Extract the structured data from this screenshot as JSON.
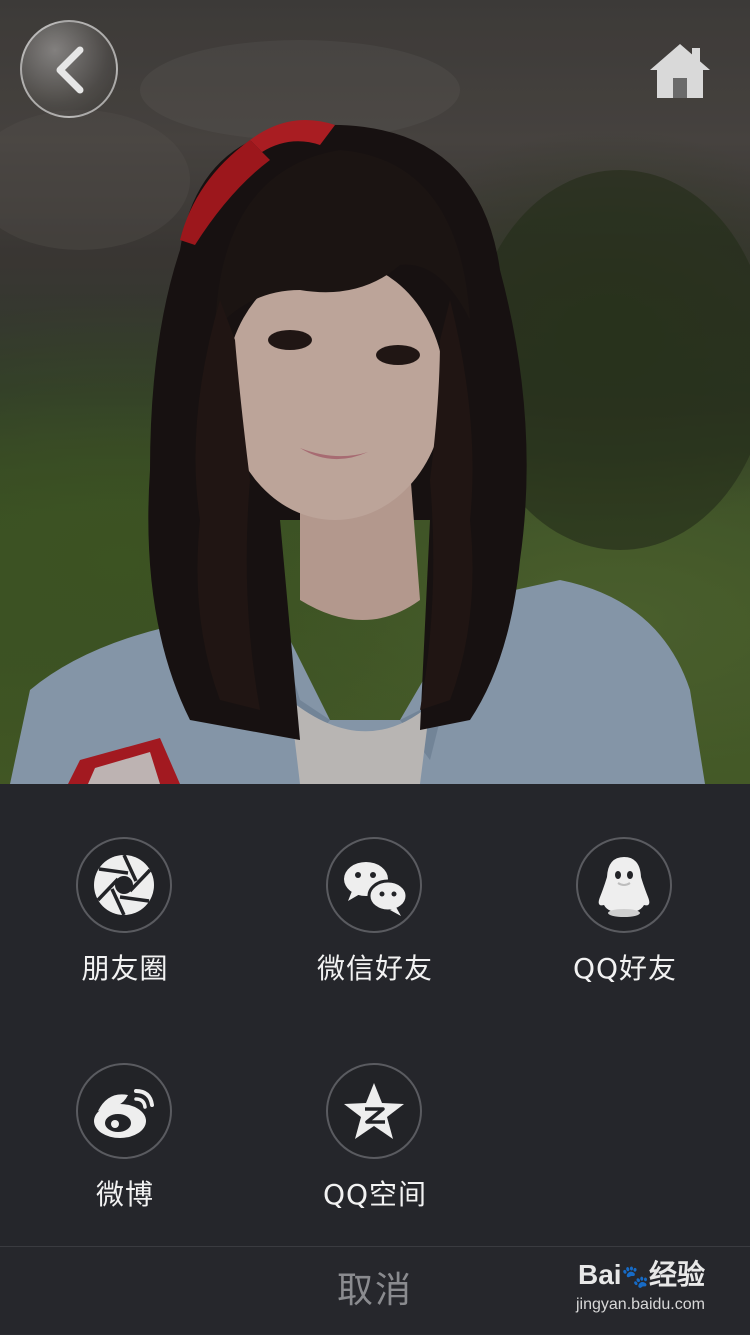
{
  "header": {
    "back_icon": "chevron-left-icon",
    "home_icon": "home-icon"
  },
  "share": {
    "items": [
      {
        "label": "朋友圈",
        "icon": "moments-aperture-icon"
      },
      {
        "label": "微信好友",
        "icon": "wechat-icon"
      },
      {
        "label": "QQ好友",
        "icon": "qq-penguin-icon"
      },
      {
        "label": "微博",
        "icon": "weibo-icon"
      },
      {
        "label": "QQ空间",
        "icon": "qzone-star-icon"
      }
    ]
  },
  "footer": {
    "cancel_label": "取消"
  },
  "watermark": {
    "logo_text": "Bai",
    "logo_text_2": "经验",
    "url": "jingyan.baidu.com"
  },
  "colors": {
    "panel_bg": "#25262b",
    "label_text": "#f2f2f2",
    "cancel_text": "#8a8b8f",
    "circle_border": "#5a5b60"
  }
}
